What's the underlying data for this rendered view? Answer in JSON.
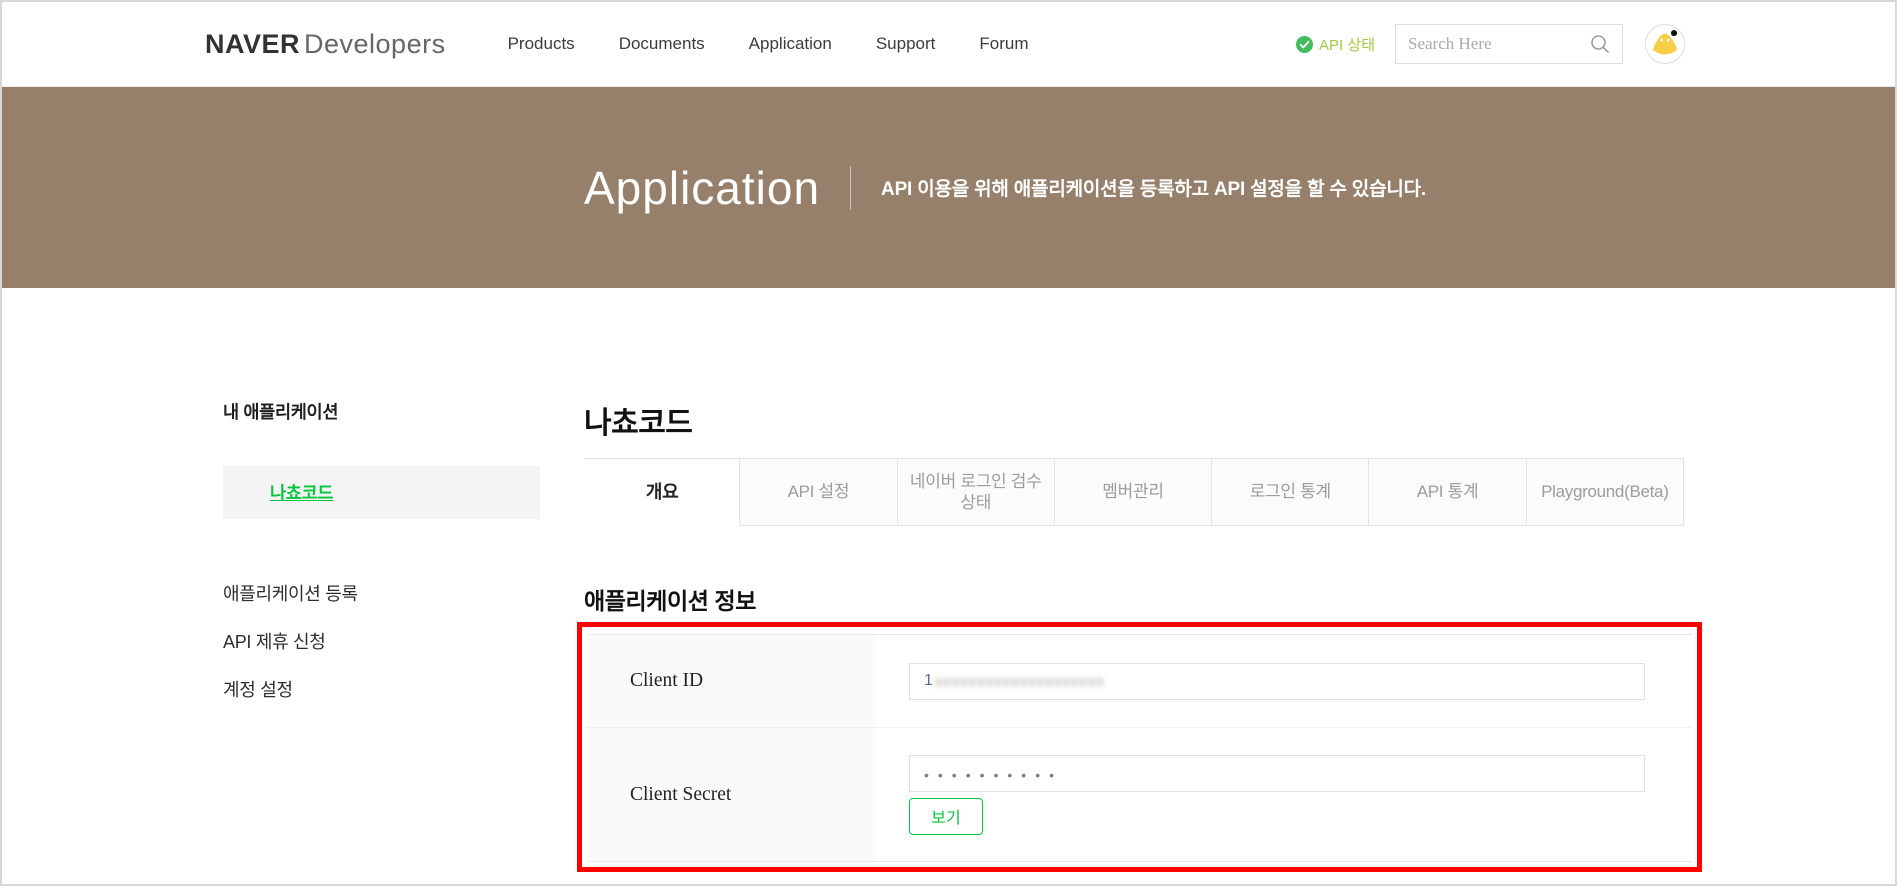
{
  "header": {
    "logo": {
      "primary": "NAVER",
      "secondary": "Developers"
    },
    "nav": [
      {
        "label": "Products"
      },
      {
        "label": "Documents"
      },
      {
        "label": "Application"
      },
      {
        "label": "Support"
      },
      {
        "label": "Forum"
      }
    ],
    "api_status": {
      "label": "API 상태",
      "icon": "check-circle-icon",
      "icon_color": "#42bd5d",
      "label_color": "#a6c83e"
    },
    "search": {
      "placeholder": "Search Here",
      "icon": "search-icon"
    },
    "avatar": {
      "icon": "user-avatar"
    }
  },
  "banner": {
    "title": "Application",
    "description": "API 이용을 위해 애플리케이션을 등록하고 API 설정을 할 수 있습니다.",
    "background_color": "#97806b"
  },
  "sidebar": {
    "heading": "내 애플리케이션",
    "selected_app": {
      "label": "나쵸코드",
      "color": "#00c73c"
    },
    "links": [
      {
        "label": "애플리케이션 등록"
      },
      {
        "label": "API 제휴 신청"
      },
      {
        "label": "계정 설정"
      }
    ]
  },
  "main": {
    "title": "나쵸코드",
    "tabs": [
      {
        "label": "개요",
        "active": true
      },
      {
        "label": "API 설정",
        "active": false
      },
      {
        "label": "네이버 로그인 검수상태",
        "active": false
      },
      {
        "label": "멤버관리",
        "active": false
      },
      {
        "label": "로그인 통계",
        "active": false
      },
      {
        "label": "API 통계",
        "active": false
      },
      {
        "label": "Playground(Beta)",
        "active": false
      }
    ],
    "section_title": "애플리케이션 정보",
    "info": {
      "client_id": {
        "label": "Client ID",
        "visible_prefix": "1",
        "blurred": true,
        "blur_placeholder": "xxxxxxxxxxxxxxxxxxxx"
      },
      "client_secret": {
        "label": "Client Secret",
        "masked_value": "••••••••••",
        "show_button_label": "보기"
      }
    },
    "annotation_color": "#ff0000"
  }
}
